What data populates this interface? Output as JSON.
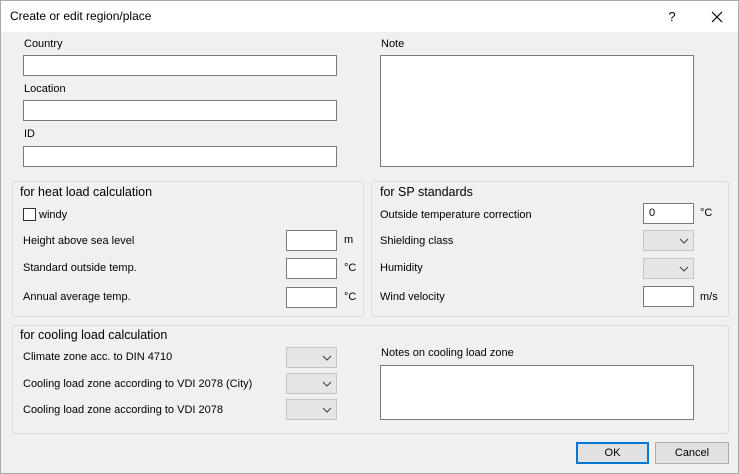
{
  "window": {
    "title": "Create or edit region/place",
    "help": "?"
  },
  "top": {
    "country_label": "Country",
    "country_value": "",
    "location_label": "Location",
    "location_value": "",
    "id_label": "ID",
    "id_value": "",
    "note_label": "Note",
    "note_value": ""
  },
  "heat": {
    "title": "for heat load calculation",
    "windy_label": "windy",
    "windy_checked": false,
    "height_label": "Height above sea level",
    "height_value": "",
    "height_unit": "m",
    "outside_temp_label": "Standard outside temp.",
    "outside_temp_value": "",
    "outside_temp_unit": "°C",
    "annual_temp_label": "Annual average temp.",
    "annual_temp_value": "",
    "annual_temp_unit": "°C"
  },
  "sp": {
    "title": "for SP standards",
    "outside_corr_label": "Outside temperature correction",
    "outside_corr_value": "0",
    "outside_corr_unit": "°C",
    "shielding_label": "Shielding class",
    "shielding_value": "",
    "humidity_label": "Humidity",
    "humidity_value": "",
    "wind_label": "Wind velocity",
    "wind_value": "",
    "wind_unit": "m/s"
  },
  "cooling": {
    "title": "for cooling load calculation",
    "climate_label": "Climate zone acc. to DIN 4710",
    "climate_value": "",
    "vdi_city_label": "Cooling load zone according to VDI 2078 (City)",
    "vdi_city_value": "",
    "vdi_label": "Cooling load zone according to VDI 2078",
    "vdi_value": "",
    "notes_label": "Notes on cooling load zone",
    "notes_value": ""
  },
  "buttons": {
    "ok": "OK",
    "cancel": "Cancel"
  },
  "colors": {
    "accent": "#0078d7",
    "background": "#f0f0f0",
    "field_border": "#7a7a7a"
  }
}
